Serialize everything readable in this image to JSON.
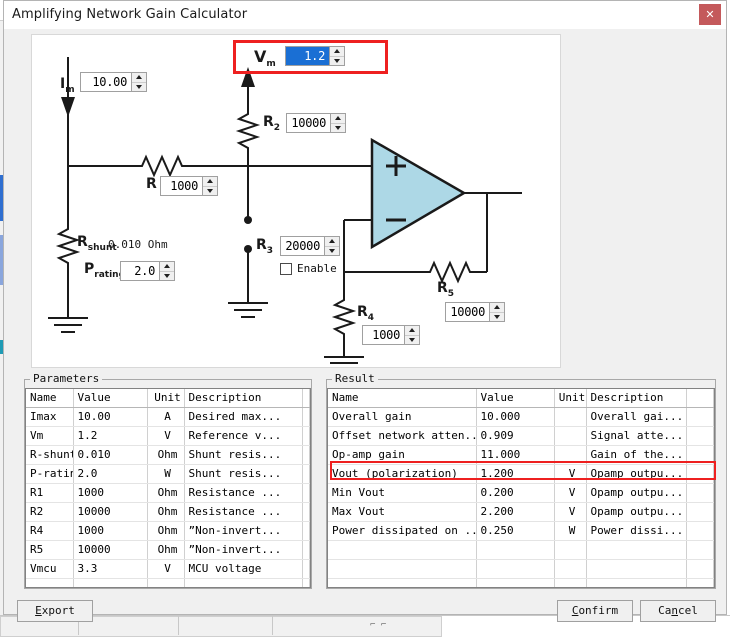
{
  "window": {
    "title": "Amplifying Network Gain Calculator",
    "close_label": "✕"
  },
  "colors": {
    "accent_red": "#ee2020",
    "opamp_fill": "#add8e6",
    "close_bg": "#c4595b",
    "selection_blue": "#1a6fd4"
  },
  "schematic": {
    "im": {
      "label": "I",
      "sub": "m",
      "value": "10.00"
    },
    "vm": {
      "label": "V",
      "sub": "m",
      "value": "1.2",
      "selected": true
    },
    "r1": {
      "label": "R",
      "sub": "",
      "value": "1000"
    },
    "r2": {
      "label": "R",
      "sub": "2",
      "value": "10000"
    },
    "r3": {
      "label": "R",
      "sub": "3",
      "value": "20000"
    },
    "r4": {
      "label": "R",
      "sub": "4",
      "value": "1000"
    },
    "r5": {
      "label": "R",
      "sub": "5",
      "value": "10000"
    },
    "rshunt": {
      "label": "R",
      "sub": "shunt",
      "text": "0.010 Ohm"
    },
    "prating": {
      "label": "P",
      "sub": "rating",
      "value": "2.0"
    },
    "enable": {
      "label": "Enable",
      "checked": false
    },
    "opamp": {
      "plus": "+",
      "minus": "−"
    }
  },
  "parameters": {
    "title": "Parameters",
    "columns": [
      "Name",
      "Value",
      "Unit",
      "Description"
    ],
    "rows": [
      [
        "Imax",
        "10.00",
        "A",
        "Desired max..."
      ],
      [
        "Vm",
        "1.2",
        "V",
        "Reference v..."
      ],
      [
        "R-shunt",
        "0.010",
        "Ohm",
        "Shunt resis..."
      ],
      [
        "P-rating",
        "2.0",
        "W",
        "Shunt resis..."
      ],
      [
        "R1",
        "1000",
        "Ohm",
        "Resistance ..."
      ],
      [
        "R2",
        "10000",
        "Ohm",
        "Resistance ..."
      ],
      [
        "R4",
        "1000",
        "Ohm",
        "”Non-invert..."
      ],
      [
        "R5",
        "10000",
        "Ohm",
        "”Non-invert..."
      ],
      [
        "Vmcu",
        "3.3",
        "V",
        "MCU voltage"
      ]
    ],
    "empty_rows": 3
  },
  "result": {
    "title": "Result",
    "columns": [
      "Name",
      "Value",
      "Unit",
      "Description"
    ],
    "rows": [
      [
        "Overall gain",
        "10.000",
        "",
        "Overall gai..."
      ],
      [
        "Offset network atten...",
        "0.909",
        "",
        "Signal atte..."
      ],
      [
        "Op-amp gain",
        "11.000",
        "",
        "Gain of the..."
      ],
      [
        "Vout (polarization)",
        "1.200",
        "V",
        "Opamp outpu..."
      ],
      [
        "Min Vout",
        "0.200",
        "V",
        "Opamp outpu..."
      ],
      [
        "Max Vout",
        "2.200",
        "V",
        "Opamp outpu..."
      ],
      [
        "Power dissipated on ...",
        "0.250",
        "W",
        "Power dissi..."
      ]
    ],
    "highlighted_row_index": 3,
    "empty_rows": 5
  },
  "buttons": {
    "export": {
      "pre": "E",
      "post": "xport"
    },
    "confirm": {
      "pre": "C",
      "post": "onfirm"
    },
    "cancel": {
      "pre": "Ca",
      "mid": "n",
      "post": "cel"
    }
  }
}
